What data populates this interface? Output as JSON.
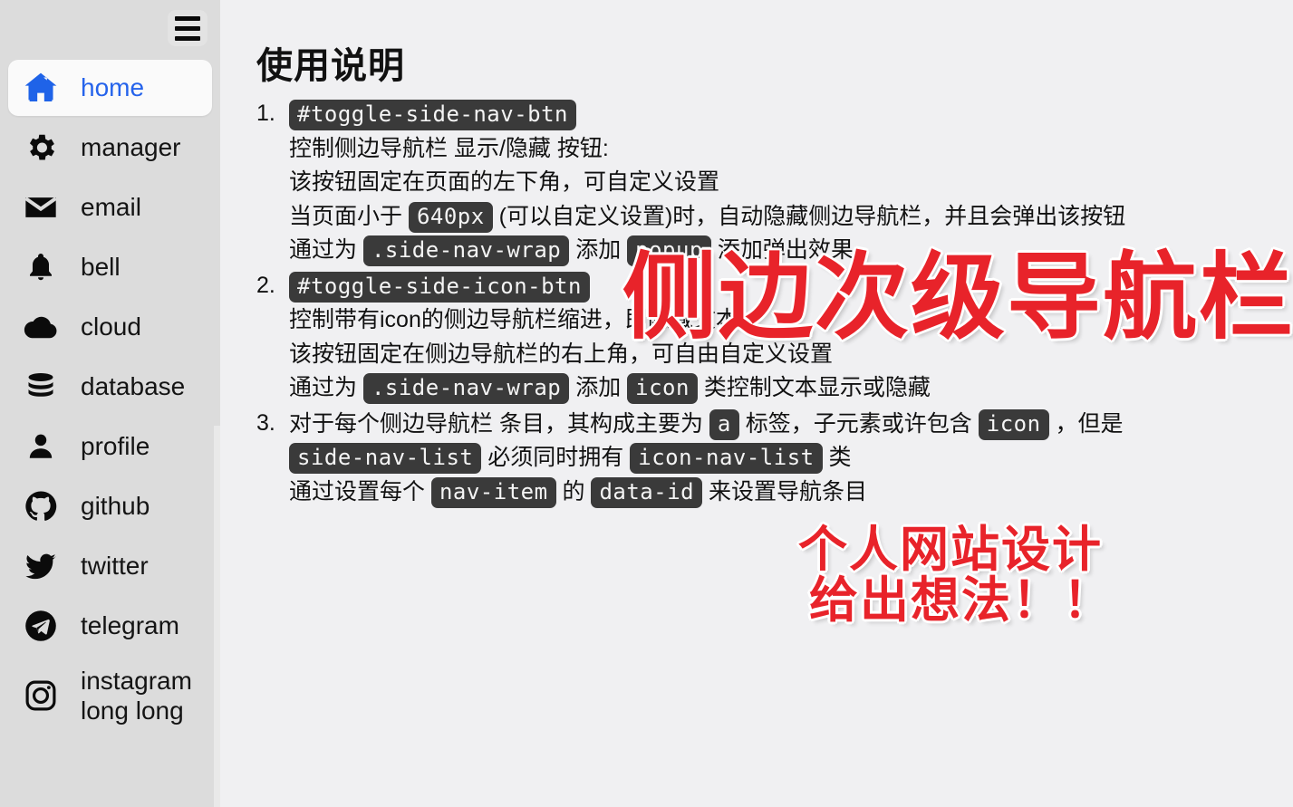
{
  "colors": {
    "sidebar_bg": "#dcdcdc",
    "main_bg": "#f0f0f2",
    "active_text": "#2563eb",
    "active_bg": "#fafafa",
    "code_bg": "#3a3a3a",
    "annotation_red": "#e8232a"
  },
  "sidebar": {
    "toggle_icon": "hamburger-icon",
    "items": [
      {
        "label": "home",
        "icon": "home-icon",
        "active": true
      },
      {
        "label": "manager",
        "icon": "gear-icon",
        "active": false
      },
      {
        "label": "email",
        "icon": "envelope-icon",
        "active": false
      },
      {
        "label": "bell",
        "icon": "bell-icon",
        "active": false
      },
      {
        "label": "cloud",
        "icon": "cloud-icon",
        "active": false
      },
      {
        "label": "database",
        "icon": "database-icon",
        "active": false
      },
      {
        "label": "profile",
        "icon": "user-icon",
        "active": false
      },
      {
        "label": "github",
        "icon": "github-icon",
        "active": false
      },
      {
        "label": "twitter",
        "icon": "twitter-icon",
        "active": false
      },
      {
        "label": "telegram",
        "icon": "telegram-icon",
        "active": false
      },
      {
        "label": "instagram long long",
        "icon": "instagram-icon",
        "active": false
      }
    ]
  },
  "main": {
    "title": "使用说明",
    "items": [
      {
        "number": "1.",
        "lines": [
          [
            {
              "type": "code",
              "text": "#toggle-side-nav-btn"
            }
          ],
          [
            {
              "type": "text",
              "text": "控制侧边导航栏 显示/隐藏 按钮:"
            }
          ],
          [
            {
              "type": "text",
              "text": "该按钮固定在页面的左下角，可自定义设置"
            }
          ],
          [
            {
              "type": "text",
              "text": "当页面小于 "
            },
            {
              "type": "code",
              "text": "640px"
            },
            {
              "type": "text",
              "text": " (可以自定义设置)时，自动隐藏侧边导航栏，并且会弹出该按钮"
            }
          ],
          [
            {
              "type": "text",
              "text": "通过为 "
            },
            {
              "type": "code",
              "text": ".side-nav-wrap"
            },
            {
              "type": "text",
              "text": " 添加 "
            },
            {
              "type": "code",
              "text": "popup"
            },
            {
              "type": "text",
              "text": " 添加弹出效果"
            }
          ]
        ]
      },
      {
        "number": "2.",
        "lines": [
          [
            {
              "type": "code",
              "text": "#toggle-side-icon-btn"
            }
          ],
          [
            {
              "type": "text",
              "text": "控制带有icon的侧边导航栏缩进，即隐藏文本"
            }
          ],
          [
            {
              "type": "text",
              "text": "该按钮固定在侧边导航栏的右上角，可自由自定义设置"
            }
          ],
          [
            {
              "type": "text",
              "text": "通过为 "
            },
            {
              "type": "code",
              "text": ".side-nav-wrap"
            },
            {
              "type": "text",
              "text": " 添加 "
            },
            {
              "type": "code",
              "text": "icon"
            },
            {
              "type": "text",
              "text": " 类控制文本显示或隐藏"
            }
          ]
        ]
      },
      {
        "number": "3.",
        "lines": [
          [
            {
              "type": "text",
              "text": "对于每个侧边导航栏 条目，其构成主要为 "
            },
            {
              "type": "code",
              "text": "a"
            },
            {
              "type": "text",
              "text": " 标签，子元素或许包含 "
            },
            {
              "type": "code",
              "text": "icon"
            },
            {
              "type": "text",
              "text": " ，但是"
            }
          ],
          [
            {
              "type": "code",
              "text": "side-nav-list"
            },
            {
              "type": "text",
              "text": " 必须同时拥有 "
            },
            {
              "type": "code",
              "text": "icon-nav-list"
            },
            {
              "type": "text",
              "text": " 类"
            }
          ],
          [
            {
              "type": "text",
              "text": "通过设置每个 "
            },
            {
              "type": "code",
              "text": "nav-item"
            },
            {
              "type": "text",
              "text": " 的 "
            },
            {
              "type": "code",
              "text": "data-id"
            },
            {
              "type": "text",
              "text": " 来设置导航条目"
            }
          ]
        ]
      }
    ]
  },
  "annotations": {
    "main": "侧边次级导航栏",
    "sub1": "个人网站设计",
    "sub2": "给出想法！！"
  }
}
